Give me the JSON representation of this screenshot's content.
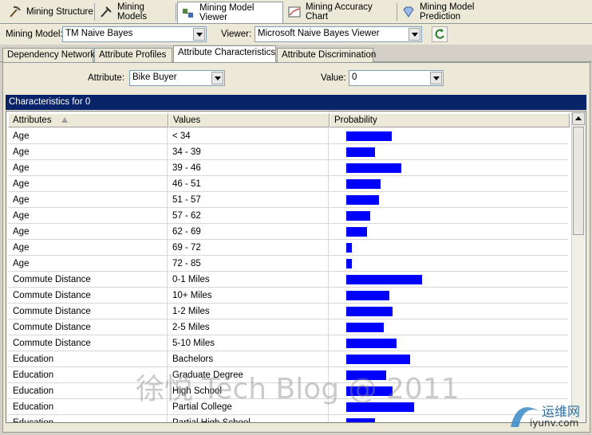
{
  "top_tabs": [
    {
      "label": "Mining Structure",
      "icon": "pickaxe-icon"
    },
    {
      "label": "Mining Models",
      "icon": "pick-icon"
    },
    {
      "label": "Mining Model Viewer",
      "icon": "viewer-icon"
    },
    {
      "label": "Mining Accuracy Chart",
      "icon": "chart-icon"
    },
    {
      "label": "Mining Model Prediction",
      "icon": "diamond-icon"
    }
  ],
  "toolbar": {
    "model_label": "Mining Model:",
    "model_value": "TM Naive Bayes",
    "viewer_label": "Viewer:",
    "viewer_value": "Microsoft Naive Bayes Viewer"
  },
  "sub_tabs": [
    "Dependency Network",
    "Attribute Profiles",
    "Attribute Characteristics",
    "Attribute Discrimination"
  ],
  "filters": {
    "attribute_label": "Attribute:",
    "attribute_value": "Bike Buyer",
    "value_label": "Value:",
    "value_value": "0"
  },
  "characteristics_title": "Characteristics for 0",
  "columns": [
    "Attributes",
    "Values",
    "Probability"
  ],
  "rows": [
    {
      "attribute": "Age",
      "value": "< 34",
      "probability": 0.42
    },
    {
      "attribute": "Age",
      "value": "34 - 39",
      "probability": 0.27
    },
    {
      "attribute": "Age",
      "value": "39 - 46",
      "probability": 0.51
    },
    {
      "attribute": "Age",
      "value": "46 - 51",
      "probability": 0.32
    },
    {
      "attribute": "Age",
      "value": "51 - 57",
      "probability": 0.3
    },
    {
      "attribute": "Age",
      "value": "57 - 62",
      "probability": 0.22
    },
    {
      "attribute": "Age",
      "value": "62 - 69",
      "probability": 0.19
    },
    {
      "attribute": "Age",
      "value": "69 - 72",
      "probability": 0.05
    },
    {
      "attribute": "Age",
      "value": "72 - 85",
      "probability": 0.05
    },
    {
      "attribute": "Commute Distance",
      "value": "0-1 Miles",
      "probability": 0.7
    },
    {
      "attribute": "Commute Distance",
      "value": "10+ Miles",
      "probability": 0.4
    },
    {
      "attribute": "Commute Distance",
      "value": "1-2 Miles",
      "probability": 0.43
    },
    {
      "attribute": "Commute Distance",
      "value": "2-5 Miles",
      "probability": 0.35
    },
    {
      "attribute": "Commute Distance",
      "value": "5-10 Miles",
      "probability": 0.47
    },
    {
      "attribute": "Education",
      "value": "Bachelors",
      "probability": 0.59
    },
    {
      "attribute": "Education",
      "value": "Graduate Degree",
      "probability": 0.37
    },
    {
      "attribute": "Education",
      "value": "High School",
      "probability": 0.43
    },
    {
      "attribute": "Education",
      "value": "Partial College",
      "probability": 0.63
    },
    {
      "attribute": "Education",
      "value": "Partial High School",
      "probability": 0.27
    }
  ],
  "watermark": "徐悦 Tech Blog @ 2011",
  "logo": {
    "text1": "运维网",
    "text2": "iyunv.com"
  },
  "colors": {
    "bar": "#0000ff",
    "header": "#0a246a"
  }
}
